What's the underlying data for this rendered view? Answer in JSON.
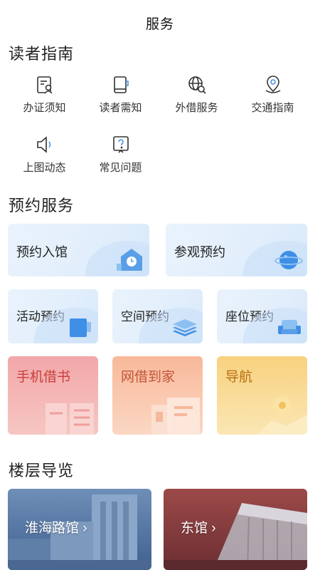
{
  "header": {
    "title": "服务"
  },
  "sections": {
    "guide": "读者指南",
    "booking": "预约服务",
    "floors": "楼层导览"
  },
  "guide_items": [
    {
      "label": "办证须知",
      "icon": "id-card-icon"
    },
    {
      "label": "读者需知",
      "icon": "book-icon"
    },
    {
      "label": "外借服务",
      "icon": "globe-search-icon"
    },
    {
      "label": "交通指南",
      "icon": "location-pin-icon"
    },
    {
      "label": "上图动态",
      "icon": "speaker-icon"
    },
    {
      "label": "常见问题",
      "icon": "question-icon"
    }
  ],
  "booking": {
    "library_entry": "预约入馆",
    "visit": "参观预约",
    "activity": "活动预约",
    "space": "空间预约",
    "seat": "座位预约",
    "mobile_borrow": "手机借书",
    "online_borrow": "网借到家",
    "navigation": "导航"
  },
  "floors": {
    "huaihai": "淮海路馆",
    "east": "东馆"
  },
  "colors": {
    "accent_blue": "#4a90e2",
    "card_blue": "#e4f0fb",
    "pink": "#f2a7a9",
    "orange": "#f8b99a",
    "yellow": "#f7d27f"
  }
}
